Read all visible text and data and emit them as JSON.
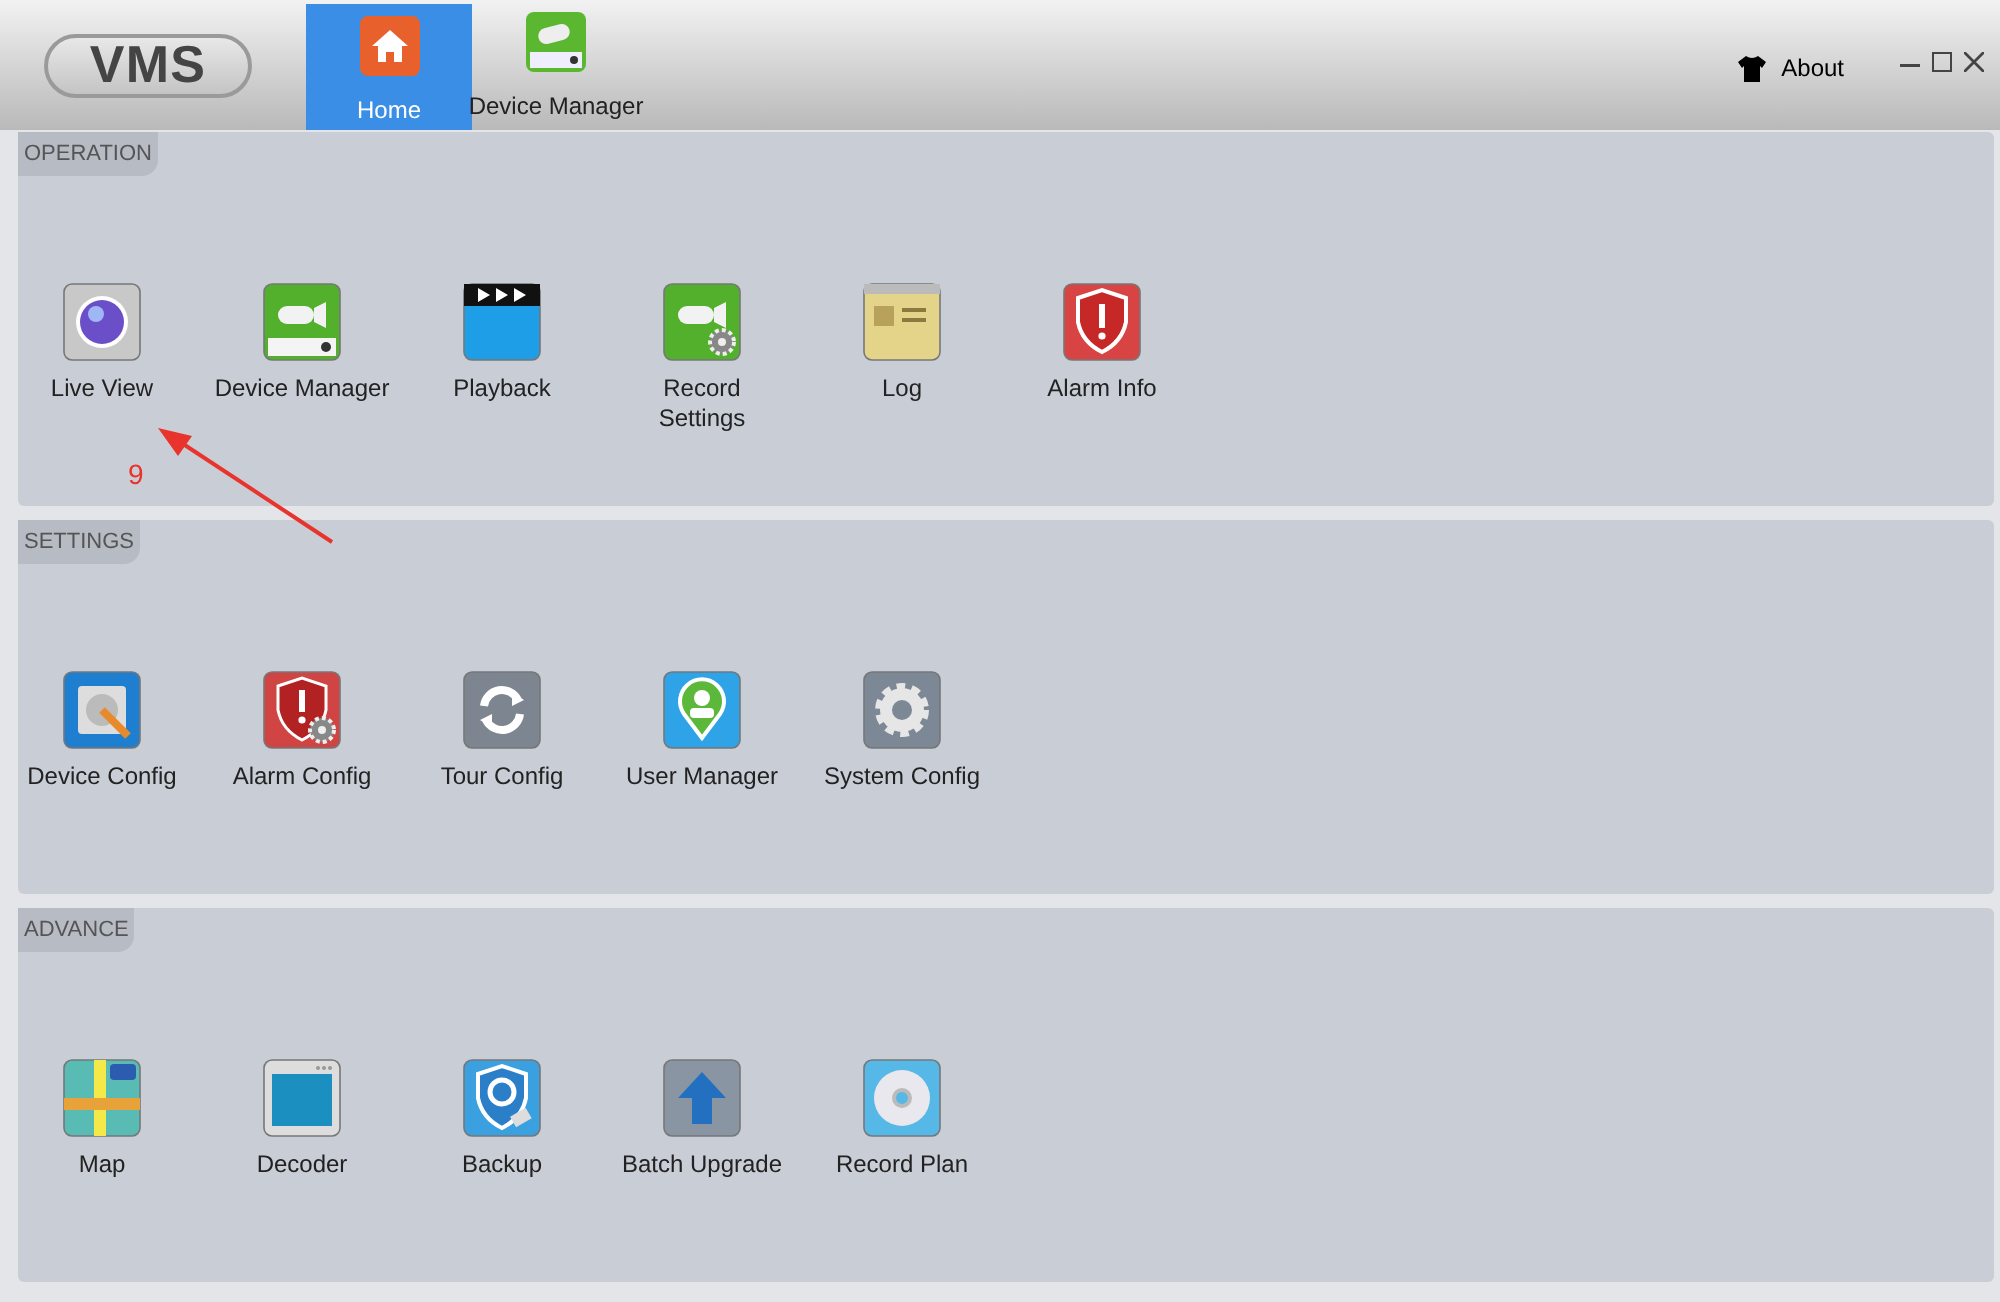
{
  "app": {
    "logo": "VMS",
    "tabs": [
      {
        "label": "Home",
        "selected": true
      },
      {
        "label": "Device Manager",
        "selected": false
      }
    ],
    "about": "About"
  },
  "sections": [
    {
      "title": "OPERATION",
      "items": [
        {
          "label": "Live View"
        },
        {
          "label": "Device Manager"
        },
        {
          "label": "Playback"
        },
        {
          "label": "Record\nSettings"
        },
        {
          "label": "Log"
        },
        {
          "label": "Alarm Info"
        }
      ]
    },
    {
      "title": "SETTINGS",
      "items": [
        {
          "label": "Device Config"
        },
        {
          "label": "Alarm Config"
        },
        {
          "label": "Tour Config"
        },
        {
          "label": "User Manager"
        },
        {
          "label": "System Config"
        }
      ]
    },
    {
      "title": "ADVANCE",
      "items": [
        {
          "label": "Map"
        },
        {
          "label": "Decoder"
        },
        {
          "label": "Backup"
        },
        {
          "label": "Batch Upgrade"
        },
        {
          "label": "Record Plan"
        }
      ]
    }
  ],
  "annotation": {
    "text": "9"
  }
}
